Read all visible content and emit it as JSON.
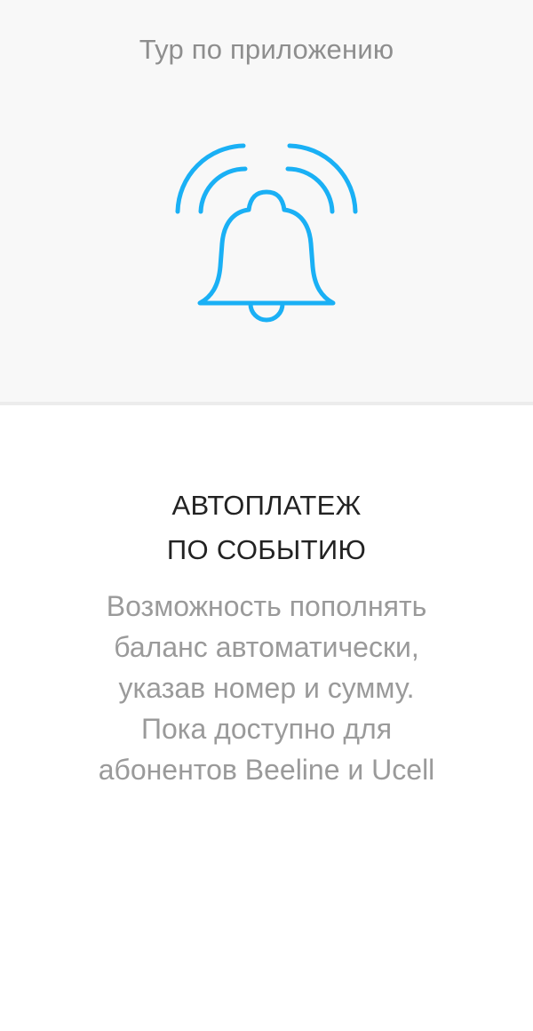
{
  "header": {
    "title": "Тур по приложению"
  },
  "illustration": {
    "icon": "bell-ringing-icon",
    "color": "#1ab0f5"
  },
  "slide": {
    "heading_lines": [
      "АВТОПЛАТЕЖ",
      "ПО СОБЫТИЮ"
    ],
    "description_lines": [
      "Возможность пополнять",
      "баланс автоматически,",
      "указав номер и сумму.",
      "Пока доступно для",
      "абонентов Beeline и Ucell"
    ]
  },
  "colors": {
    "top_panel_bg": "#f8f8f8",
    "title_text": "#8e8e8e",
    "heading_text": "#222222",
    "description_text": "#9a9a9a",
    "accent": "#1ab0f5"
  }
}
